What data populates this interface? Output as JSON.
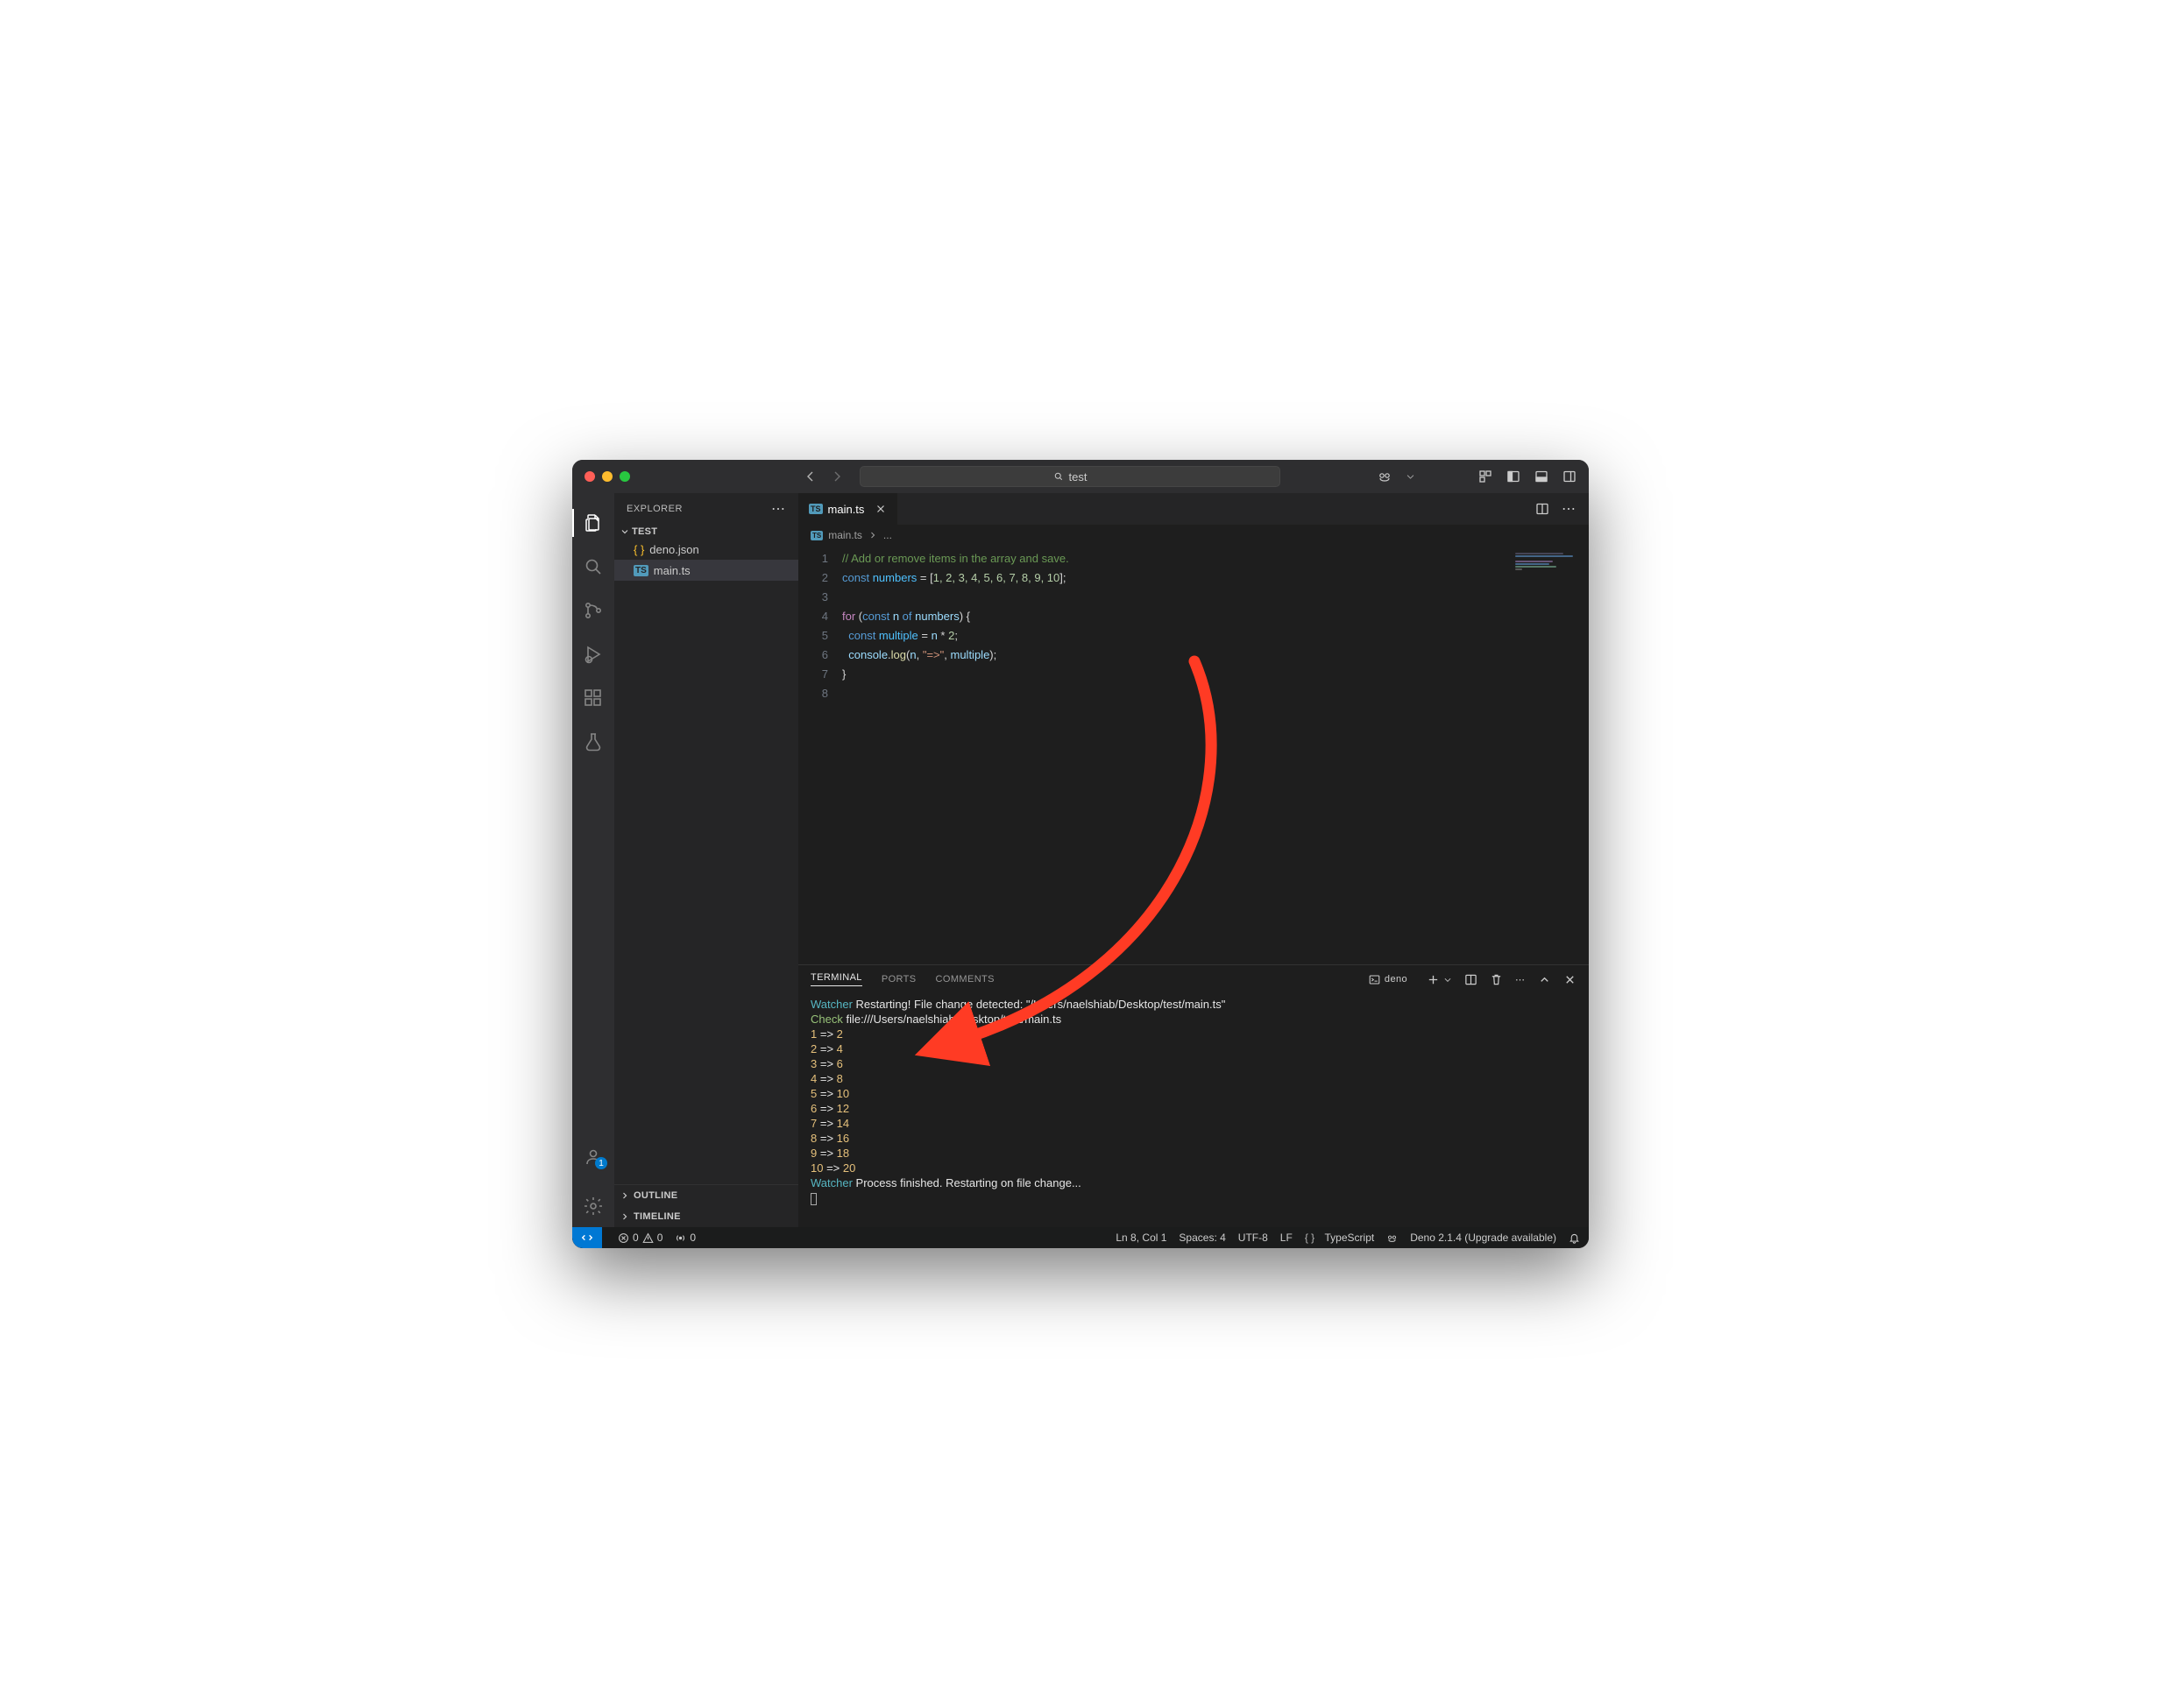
{
  "titlebar": {
    "search_text": "test"
  },
  "explorer": {
    "title": "EXPLORER",
    "folder": "TEST",
    "files": [
      {
        "name": "deno.json"
      },
      {
        "name": "main.ts"
      }
    ],
    "outline": "OUTLINE",
    "timeline": "TIMELINE",
    "account_badge": "1"
  },
  "tab": {
    "file": "main.ts"
  },
  "breadcrumb": {
    "file": "main.ts",
    "more": "..."
  },
  "code": {
    "lines": [
      "1",
      "2",
      "3",
      "4",
      "5",
      "6",
      "7",
      "8"
    ],
    "l1": "// Add or remove items in the array and save.",
    "l2_kw": "const",
    "l2_var": " numbers",
    "l2_eq": " = [",
    "l2_nums": "1, 2, 3, 4, 5, 6, 7, 8, 9, 10",
    "l2_end": "];",
    "l4_for": "for",
    "l4_p1": " (",
    "l4_const": "const",
    "l4_n": " n ",
    "l4_of": "of",
    "l4_nums": " numbers",
    "l4_p2": ") {",
    "l5_const": "const",
    "l5_mult": " multiple",
    "l5_eq": " = ",
    "l5_n": "n",
    "l5_op": " * ",
    "l5_two": "2",
    "l5_end": ";",
    "l6_console": "console",
    "l6_dot": ".",
    "l6_log": "log",
    "l6_p1": "(",
    "l6_n": "n",
    "l6_c1": ", ",
    "l6_str": "\"=>\"",
    "l6_c2": ", ",
    "l6_mult": "multiple",
    "l6_p2": ");",
    "l7": "}"
  },
  "panel": {
    "tabs": {
      "terminal": "TERMINAL",
      "ports": "PORTS",
      "comments": "COMMENTS"
    },
    "shell_label": "deno",
    "terminal": {
      "watcher": "Watcher",
      "restart": " Restarting! File change detected: \"/Users/naelshiab/Desktop/test/main.ts\"",
      "check": "Check",
      "check_path": " file:///Users/naelshiab/Desktop/test/main.ts",
      "rows": [
        {
          "a": "1",
          "arr": " => ",
          "b": "2"
        },
        {
          "a": "2",
          "arr": " => ",
          "b": "4"
        },
        {
          "a": "3",
          "arr": " => ",
          "b": "6"
        },
        {
          "a": "4",
          "arr": " => ",
          "b": "8"
        },
        {
          "a": "5",
          "arr": " => ",
          "b": "10"
        },
        {
          "a": "6",
          "arr": " => ",
          "b": "12"
        },
        {
          "a": "7",
          "arr": " => ",
          "b": "14"
        },
        {
          "a": "8",
          "arr": " => ",
          "b": "16"
        },
        {
          "a": "9",
          "arr": " => ",
          "b": "18"
        },
        {
          "a": "10",
          "arr": " => ",
          "b": "20"
        }
      ],
      "watcher2": "Watcher",
      "finished": " Process finished. Restarting on file change..."
    }
  },
  "statusbar": {
    "errors": "0",
    "warnings": "0",
    "radio": "0",
    "position": "Ln 8, Col 1",
    "spaces": "Spaces: 4",
    "encoding": "UTF-8",
    "eol": "LF",
    "lang": "TypeScript",
    "deno": "Deno 2.1.4 (Upgrade available)"
  }
}
